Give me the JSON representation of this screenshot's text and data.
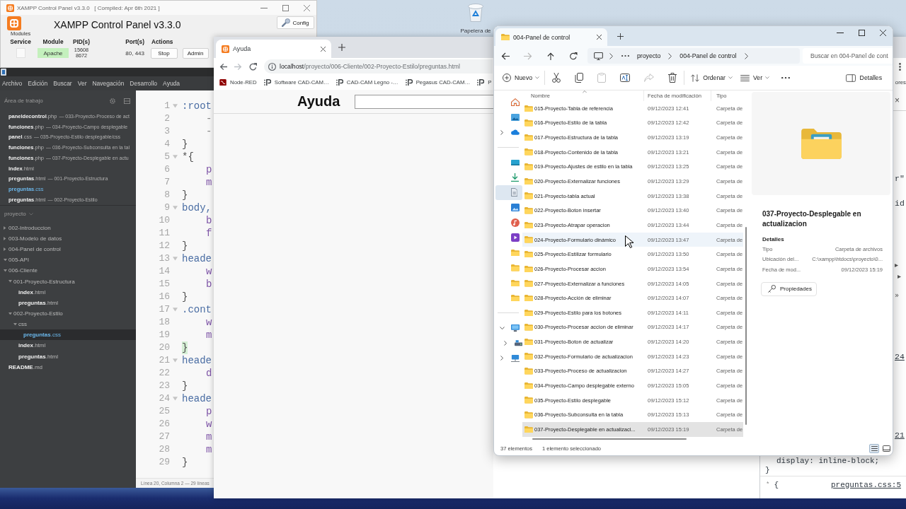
{
  "desktop": {
    "icons": [
      {
        "label": "Papelera de"
      }
    ]
  },
  "xampp": {
    "title": "XAMPP Control Panel v3.3.0   [ Compiled: Apr 6th 2021 ]",
    "heading": "XAMPP Control Panel v3.3.0",
    "modules_label": "Modules",
    "side_buttons": [
      "Config"
    ],
    "columns": [
      "Service",
      "Module",
      "PID(s)",
      "Port(s)",
      "Actions"
    ],
    "modules": [
      {
        "service": false,
        "name": "Apache",
        "running": true,
        "pids": [
          "15608",
          "8672"
        ],
        "ports": "80, 443",
        "actions": [
          "Stop",
          "Admin"
        ]
      }
    ]
  },
  "editor": {
    "menu": [
      "Archivo",
      "Edición",
      "Buscar",
      "Ver",
      "Navegación",
      "Desarrollo",
      "Ayuda"
    ],
    "sidebar": {
      "title": "Área de trabajo",
      "working_files": [
        {
          "name": "**paneldecontrol**.php",
          "dir": "— 033-Proyecto-Proceso de act",
          "selected": false
        },
        {
          "name": "**funciones**.php",
          "dir": "— 034-Proyecto-Campo desplegable",
          "selected": false
        },
        {
          "name": "**panel**.css",
          "dir": "— 035-Proyecto-Estilo desplegable/css",
          "selected": false
        },
        {
          "name": "**funciones**.php",
          "dir": "— 036-Proyecto-Subconsulta en la tal",
          "selected": false
        },
        {
          "name": "**funciones**.php",
          "dir": "— 037-Proyecto-Desplegable en actu",
          "selected": false
        },
        {
          "name": "**index**.html",
          "selected": false
        },
        {
          "name": "**preguntas**.html",
          "dir": "— 001-Proyecto-Estructura",
          "selected": false
        },
        {
          "name": "**preguntas**.css",
          "selected": true
        },
        {
          "name": "**preguntas**.html",
          "dir": "— 002-Proyecto-Estilo",
          "selected": false
        }
      ],
      "project": "proyecto",
      "tree": [
        {
          "kind": "folder",
          "name": "002-Introduccion",
          "expanded": false,
          "selected": false
        },
        {
          "kind": "folder",
          "name": "003-Modelo de datos",
          "expanded": false,
          "selected": false
        },
        {
          "kind": "folder",
          "name": "004-Panel de control",
          "expanded": false,
          "selected": false
        },
        {
          "kind": "folder",
          "name": "005-API",
          "expanded": true,
          "selected": false
        },
        {
          "kind": "folder",
          "name": "006-Cliente",
          "expanded": true,
          "selected": false,
          "children": [
            {
              "kind": "folder",
              "name": "001-Proyecto-Estructura",
              "expanded": true,
              "selected": false,
              "children": [
                {
                  "kind": "file",
                  "name": "**index**.html",
                  "selected": false
                },
                {
                  "kind": "file",
                  "name": "**preguntas**.html",
                  "selected": false
                }
              ]
            },
            {
              "kind": "folder",
              "name": "002-Proyecto-Estilo",
              "expanded": true,
              "selected": false,
              "children": [
                {
                  "kind": "folder",
                  "name": "css",
                  "expanded": true,
                  "selected": false,
                  "children": [
                    {
                      "kind": "file",
                      "name": "**preguntas**.css",
                      "selected": true
                    }
                  ]
                },
                {
                  "kind": "file",
                  "name": "**index**.html",
                  "selected": false
                },
                {
                  "kind": "file",
                  "name": "**preguntas**.html",
                  "selected": false
                }
              ]
            }
          ]
        },
        {
          "kind": "file",
          "name": "**README**.md",
          "selected": false
        }
      ]
    },
    "code_lines": [
      {
        "number": "1",
        "kind": "selector",
        "text": ":root",
        "fold": true,
        "highlighted": false
      },
      {
        "number": "2",
        "kind": "variable",
        "text": "-",
        "fold": false,
        "highlighted": false
      },
      {
        "number": "3",
        "kind": "variable",
        "text": "-",
        "fold": false,
        "highlighted": false
      },
      {
        "number": "4",
        "kind": "brace",
        "text": "}",
        "fold": false,
        "highlighted": false
      },
      {
        "number": "5",
        "kind": "brace",
        "text": "*{",
        "fold": true,
        "highlighted": false
      },
      {
        "number": "6",
        "kind": "property",
        "text": "p",
        "fold": false,
        "highlighted": false
      },
      {
        "number": "7",
        "kind": "property",
        "text": "m",
        "fold": false,
        "highlighted": false
      },
      {
        "number": "8",
        "kind": "brace",
        "text": "}",
        "fold": false,
        "highlighted": false
      },
      {
        "number": "9",
        "kind": "selector",
        "text": "body,",
        "fold": true,
        "highlighted": false
      },
      {
        "number": "10",
        "kind": "property",
        "text": "b",
        "fold": false,
        "highlighted": false
      },
      {
        "number": "11",
        "kind": "property",
        "text": "f",
        "fold": false,
        "highlighted": false
      },
      {
        "number": "12",
        "kind": "brace",
        "text": "}",
        "fold": false,
        "highlighted": false
      },
      {
        "number": "13",
        "kind": "selector",
        "text": "heade",
        "fold": true,
        "highlighted": false
      },
      {
        "number": "14",
        "kind": "property",
        "text": "w",
        "fold": false,
        "highlighted": false
      },
      {
        "number": "15",
        "kind": "property",
        "text": "b",
        "fold": false,
        "highlighted": false
      },
      {
        "number": "16",
        "kind": "brace",
        "text": "}",
        "fold": false,
        "highlighted": false
      },
      {
        "number": "17",
        "kind": "selector",
        "text": ".cont",
        "fold": true,
        "highlighted": false
      },
      {
        "number": "18",
        "kind": "property",
        "text": "w",
        "fold": false,
        "highlighted": false
      },
      {
        "number": "19",
        "kind": "property",
        "text": "m",
        "fold": false,
        "highlighted": false
      },
      {
        "number": "20",
        "kind": "brace",
        "text": "}",
        "fold": false,
        "highlighted": true
      },
      {
        "number": "21",
        "kind": "selector",
        "text": "heade",
        "fold": true,
        "highlighted": false
      },
      {
        "number": "22",
        "kind": "property",
        "text": "d",
        "fold": false,
        "highlighted": false
      },
      {
        "number": "23",
        "kind": "brace",
        "text": "}",
        "fold": false,
        "highlighted": false
      },
      {
        "number": "24",
        "kind": "selector",
        "text": "heade",
        "fold": true,
        "highlighted": false
      },
      {
        "number": "25",
        "kind": "property",
        "text": "p",
        "fold": false,
        "highlighted": false
      },
      {
        "number": "26",
        "kind": "property",
        "text": "w",
        "fold": false,
        "highlighted": false
      },
      {
        "number": "27",
        "kind": "property",
        "text": "m",
        "fold": false,
        "highlighted": false
      },
      {
        "number": "28",
        "kind": "property",
        "text": "m",
        "fold": false,
        "highlighted": false
      },
      {
        "number": "29",
        "kind": "brace",
        "text": "}",
        "fold": false,
        "highlighted": false
      }
    ],
    "status": "Línea 20, Columna 2 — 29 líneas"
  },
  "browser": {
    "tabs": [
      {
        "title": "Ayuda",
        "selected": true
      }
    ],
    "nav_buttons": [
      {
        "kind": "back",
        "disabled": false
      },
      {
        "kind": "forward",
        "disabled": true
      },
      {
        "kind": "reload",
        "disabled": false
      }
    ],
    "address": {
      "host": "localhost",
      "path": "/proyecto/006-Cliente/002-Proyecto-Estilo/preguntas.html"
    },
    "bookmarks": [
      {
        "kind": "diagram",
        "label": "Node-RED"
      },
      {
        "kind": "mark",
        "label": "Software CAD-CAM…"
      },
      {
        "kind": "mark",
        "label": "CAD-CAM Legno -…"
      },
      {
        "kind": "mark",
        "label": "Pegasus CAD-CAM…"
      },
      {
        "kind": "mark",
        "label": "P"
      }
    ],
    "bookmarks_end": "ores",
    "page": {
      "heading": "Ayuda"
    },
    "devtools": {
      "close": "×",
      "edge": [
        {
          "kind": "code",
          "text": "r\""
        },
        {
          "kind": "code",
          "text": "id"
        },
        {
          "kind": "caret",
          "text": "▸"
        },
        {
          "kind": "caret",
          "text": "▸"
        },
        {
          "kind": "overflow",
          "text": "»"
        },
        {
          "kind": "link",
          "text": "24"
        },
        {
          "kind": "link",
          "text": "21"
        }
      ],
      "styles": [
        {
          "kind": "declaration",
          "text": "display: inline-block;"
        },
        {
          "kind": "close",
          "text": "}"
        },
        {
          "kind": "rule",
          "selector": "*",
          "brace": "{",
          "source": "preguntas.css:5"
        }
      ]
    }
  },
  "explorer": {
    "tabs": [
      {
        "title": "004-Panel de control",
        "selected": true
      }
    ],
    "nav_buttons": [
      {
        "kind": "back",
        "disabled": false
      },
      {
        "kind": "forward",
        "disabled": true
      },
      {
        "kind": "up",
        "disabled": false
      },
      {
        "kind": "refresh",
        "disabled": false
      }
    ],
    "breadcrumb": [
      "proyecto",
      "004-Panel de control"
    ],
    "search": {
      "placeholder": "Buscar en 004-Panel de cont"
    },
    "new_button": "Nuevo",
    "actions": [
      {
        "kind": "cut",
        "disabled": false
      },
      {
        "kind": "copy",
        "disabled": false
      },
      {
        "kind": "paste",
        "disabled": true
      },
      {
        "kind": "rename",
        "disabled": false
      },
      {
        "kind": "share",
        "disabled": true
      },
      {
        "kind": "delete",
        "disabled": false
      }
    ],
    "sort_button": "Ordenar",
    "view_button": "Ver",
    "details_button": "Detalles",
    "nav_pane": [
      {
        "kind": "home",
        "selected": false
      },
      {
        "kind": "gallery",
        "selected": false
      },
      {
        "kind": "cloud",
        "expanded": false,
        "selected": false
      },
      {
        "kind": "separator"
      },
      {
        "kind": "desktop",
        "selected": false
      },
      {
        "kind": "download",
        "selected": false
      },
      {
        "kind": "document",
        "selected": true
      },
      {
        "kind": "picture",
        "selected": false
      },
      {
        "kind": "music",
        "selected": false
      },
      {
        "kind": "video",
        "selected": false
      },
      {
        "kind": "folder",
        "selected": false
      },
      {
        "kind": "folder",
        "selected": false
      },
      {
        "kind": "folder",
        "selected": false
      },
      {
        "kind": "folder",
        "selected": false
      },
      {
        "kind": "separator"
      },
      {
        "kind": "computer",
        "expanded": true,
        "selected": false,
        "children": [
          {
            "kind": "drive",
            "expanded": false,
            "selected": false
          }
        ]
      },
      {
        "kind": "network",
        "expanded": false,
        "selected": false
      }
    ],
    "columns": [
      {
        "label": "Nombre",
        "sorted": true
      },
      {
        "label": "Fecha de modificación",
        "sorted": false
      },
      {
        "label": "Tipo",
        "sorted": false
      }
    ],
    "rows": [
      {
        "name": "015-Proyecto-Tabla de referencia",
        "date": "09/12/2023 12:41",
        "type": "Carpeta de",
        "selected": false,
        "hovered": false
      },
      {
        "name": "016-Proyecto-Estilo de la tabla",
        "date": "09/12/2023 12:42",
        "type": "Carpeta de",
        "selected": false,
        "hovered": false
      },
      {
        "name": "017-Proyecto-Estructura de la tabla",
        "date": "09/12/2023 13:19",
        "type": "Carpeta de",
        "selected": false,
        "hovered": false
      },
      {
        "name": "018-Proyecto-Contenido de la tabla",
        "date": "09/12/2023 13:21",
        "type": "Carpeta de",
        "selected": false,
        "hovered": false
      },
      {
        "name": "019-Proyecto-Ajustes de estilo en la tabla",
        "date": "09/12/2023 13:25",
        "type": "Carpeta de",
        "selected": false,
        "hovered": false
      },
      {
        "name": "020-Proyecto-Externalizar funciones",
        "date": "09/12/2023 13:29",
        "type": "Carpeta de",
        "selected": false,
        "hovered": false
      },
      {
        "name": "021-Proyecto-tabla actual",
        "date": "09/12/2023 13:38",
        "type": "Carpeta de",
        "selected": false,
        "hovered": false
      },
      {
        "name": "022-Proyecto-Boton insertar",
        "date": "09/12/2023 13:40",
        "type": "Carpeta de",
        "selected": false,
        "hovered": false
      },
      {
        "name": "023-Proyecto-Atrapar operacion",
        "date": "09/12/2023 13:44",
        "type": "Carpeta de",
        "selected": false,
        "hovered": false
      },
      {
        "name": "024-Proyecto-Formulario dinámico",
        "date": "09/12/2023 13:47",
        "type": "Carpeta de",
        "selected": false,
        "hovered": true
      },
      {
        "name": "025-Proyecto-Estilizar formulario",
        "date": "09/12/2023 13:50",
        "type": "Carpeta de",
        "selected": false,
        "hovered": false
      },
      {
        "name": "026-Proyecto-Procesar accion",
        "date": "09/12/2023 13:54",
        "type": "Carpeta de",
        "selected": false,
        "hovered": false
      },
      {
        "name": "027-Proyecto-Externalizar a funciones",
        "date": "09/12/2023 14:05",
        "type": "Carpeta de",
        "selected": false,
        "hovered": false
      },
      {
        "name": "028-Proyecto-Acción de eliminar",
        "date": "09/12/2023 14:07",
        "type": "Carpeta de",
        "selected": false,
        "hovered": false
      },
      {
        "name": "029-Proyecto-Estilo para los botones",
        "date": "09/12/2023 14:11",
        "type": "Carpeta de",
        "selected": false,
        "hovered": false
      },
      {
        "name": "030-Proyecto-Procesar accion de eliminar",
        "date": "09/12/2023 14:17",
        "type": "Carpeta de",
        "selected": false,
        "hovered": false
      },
      {
        "name": "031-Proyecto-Boton de actualizar",
        "date": "09/12/2023 14:20",
        "type": "Carpeta de",
        "selected": false,
        "hovered": false
      },
      {
        "name": "032-Proyecto-Formulario de actualizacion",
        "date": "09/12/2023 14:23",
        "type": "Carpeta de",
        "selected": false,
        "hovered": false
      },
      {
        "name": "033-Proyecto-Proceso de actualizacion",
        "date": "09/12/2023 14:27",
        "type": "Carpeta de",
        "selected": false,
        "hovered": false
      },
      {
        "name": "034-Proyecto-Campo desplegable externo",
        "date": "09/12/2023 15:05",
        "type": "Carpeta de",
        "selected": false,
        "hovered": false
      },
      {
        "name": "035-Proyecto-Estilo desplegable",
        "date": "09/12/2023 15:12",
        "type": "Carpeta de",
        "selected": false,
        "hovered": false
      },
      {
        "name": "036-Proyecto-Subconsulta en la tabla",
        "date": "09/12/2023 15:13",
        "type": "Carpeta de",
        "selected": false,
        "hovered": false
      },
      {
        "name": "037-Proyecto-Desplegable en actualizaci...",
        "date": "09/12/2023 15:19",
        "type": "Carpeta de",
        "selected": true,
        "hovered": false
      }
    ],
    "details": {
      "title": "037-Proyecto-Desplegable en actualizacion",
      "section": "Detalles",
      "properties": [
        {
          "key": "Tipo",
          "value": "Carpeta de archivos"
        },
        {
          "key": "Ubicación del...",
          "value": "C:\\xampp\\htdocs\\proyecto\\0..."
        },
        {
          "key": "Fecha de mod...",
          "value": "09/12/2023 15:19"
        }
      ],
      "button": "Propiedades"
    },
    "status": {
      "count": "37 elementos",
      "selection": "1 elemento seleccionado"
    },
    "view_toggles": [
      {
        "kind": "details",
        "selected": true
      },
      {
        "kind": "tiles",
        "selected": false
      }
    ]
  }
}
